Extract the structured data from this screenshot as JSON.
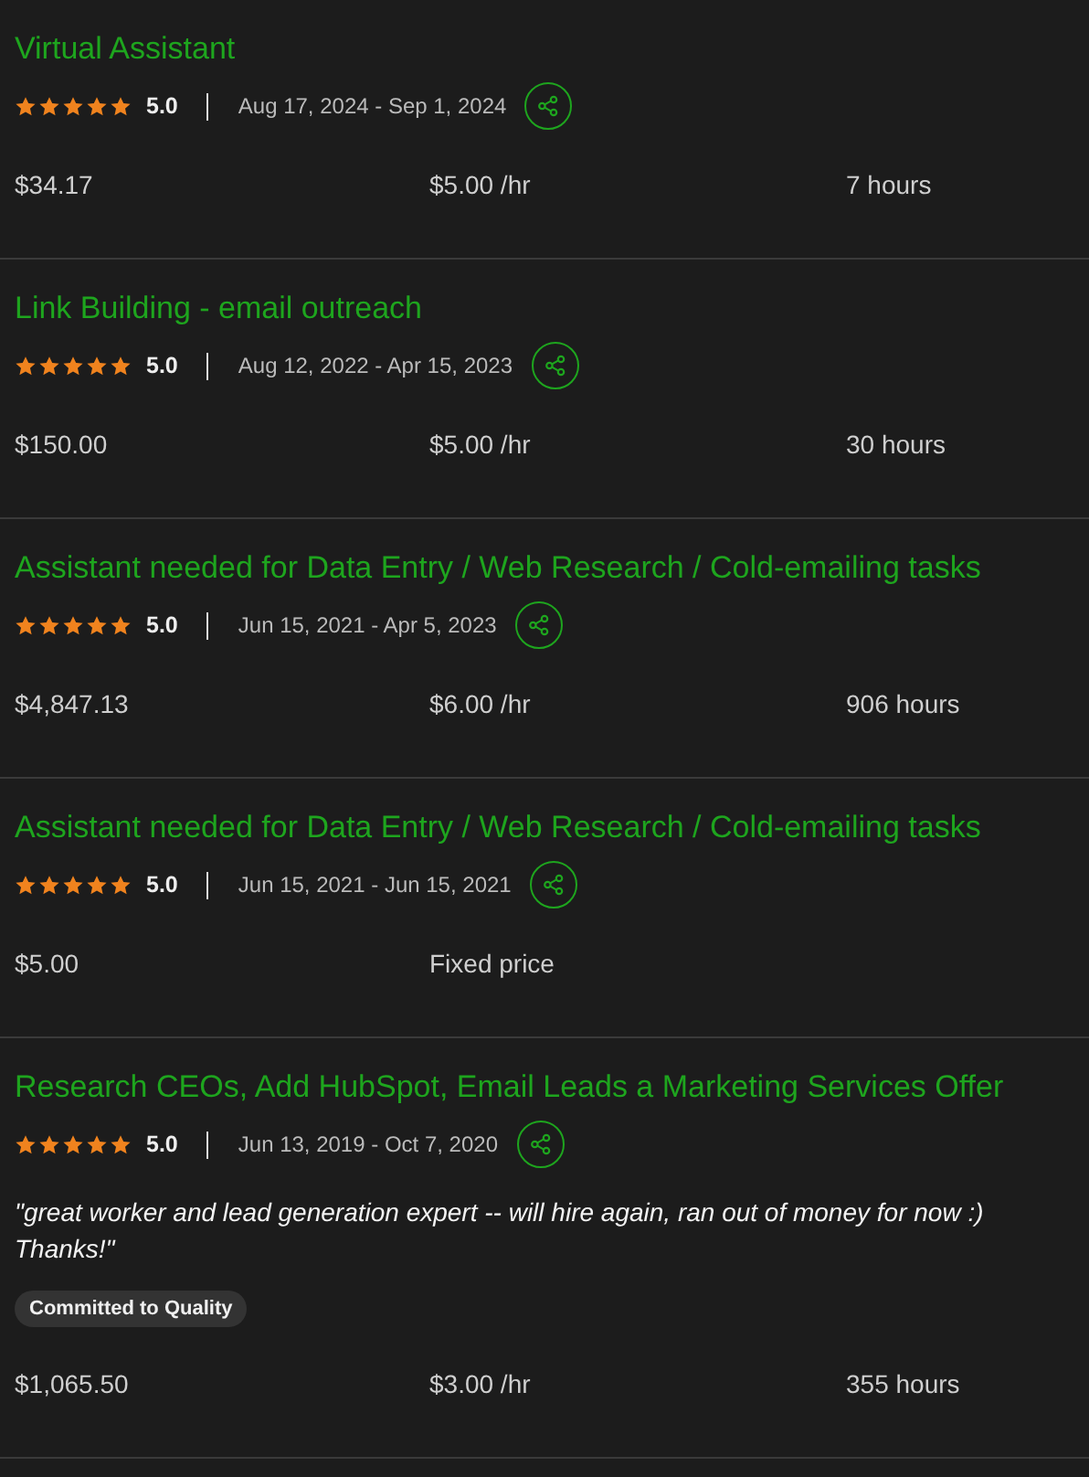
{
  "jobs": [
    {
      "title": "Virtual Assistant",
      "stars": 5,
      "rating": "5.0",
      "dates": "Aug 17, 2024 - Sep 1, 2024",
      "earned": "$34.17",
      "rate": "$5.00 /hr",
      "hours": "7 hours"
    },
    {
      "title": "Link Building - email outreach",
      "stars": 5,
      "rating": "5.0",
      "dates": "Aug 12, 2022 - Apr 15, 2023",
      "earned": "$150.00",
      "rate": "$5.00 /hr",
      "hours": "30 hours"
    },
    {
      "title": "Assistant needed for Data Entry / Web Research / Cold-emailing tasks",
      "stars": 5,
      "rating": "5.0",
      "dates": "Jun 15, 2021 - Apr 5, 2023",
      "earned": "$4,847.13",
      "rate": "$6.00 /hr",
      "hours": "906 hours"
    },
    {
      "title": "Assistant needed for Data Entry / Web Research / Cold-emailing tasks",
      "stars": 5,
      "rating": "5.0",
      "dates": "Jun 15, 2021 - Jun 15, 2021",
      "earned": "$5.00",
      "rate": "Fixed price"
    },
    {
      "title": "Research CEOs, Add HubSpot, Email Leads a Marketing Services Offer",
      "stars": 5,
      "rating": "5.0",
      "dates": "Jun 13, 2019 - Oct 7, 2020",
      "quote": "\"great worker and lead generation expert -- will hire again, ran out of money for now :) Thanks!\"",
      "tags": [
        "Committed to Quality"
      ],
      "earned": "$1,065.50",
      "rate": "$3.00 /hr",
      "hours": "355 hours"
    }
  ]
}
